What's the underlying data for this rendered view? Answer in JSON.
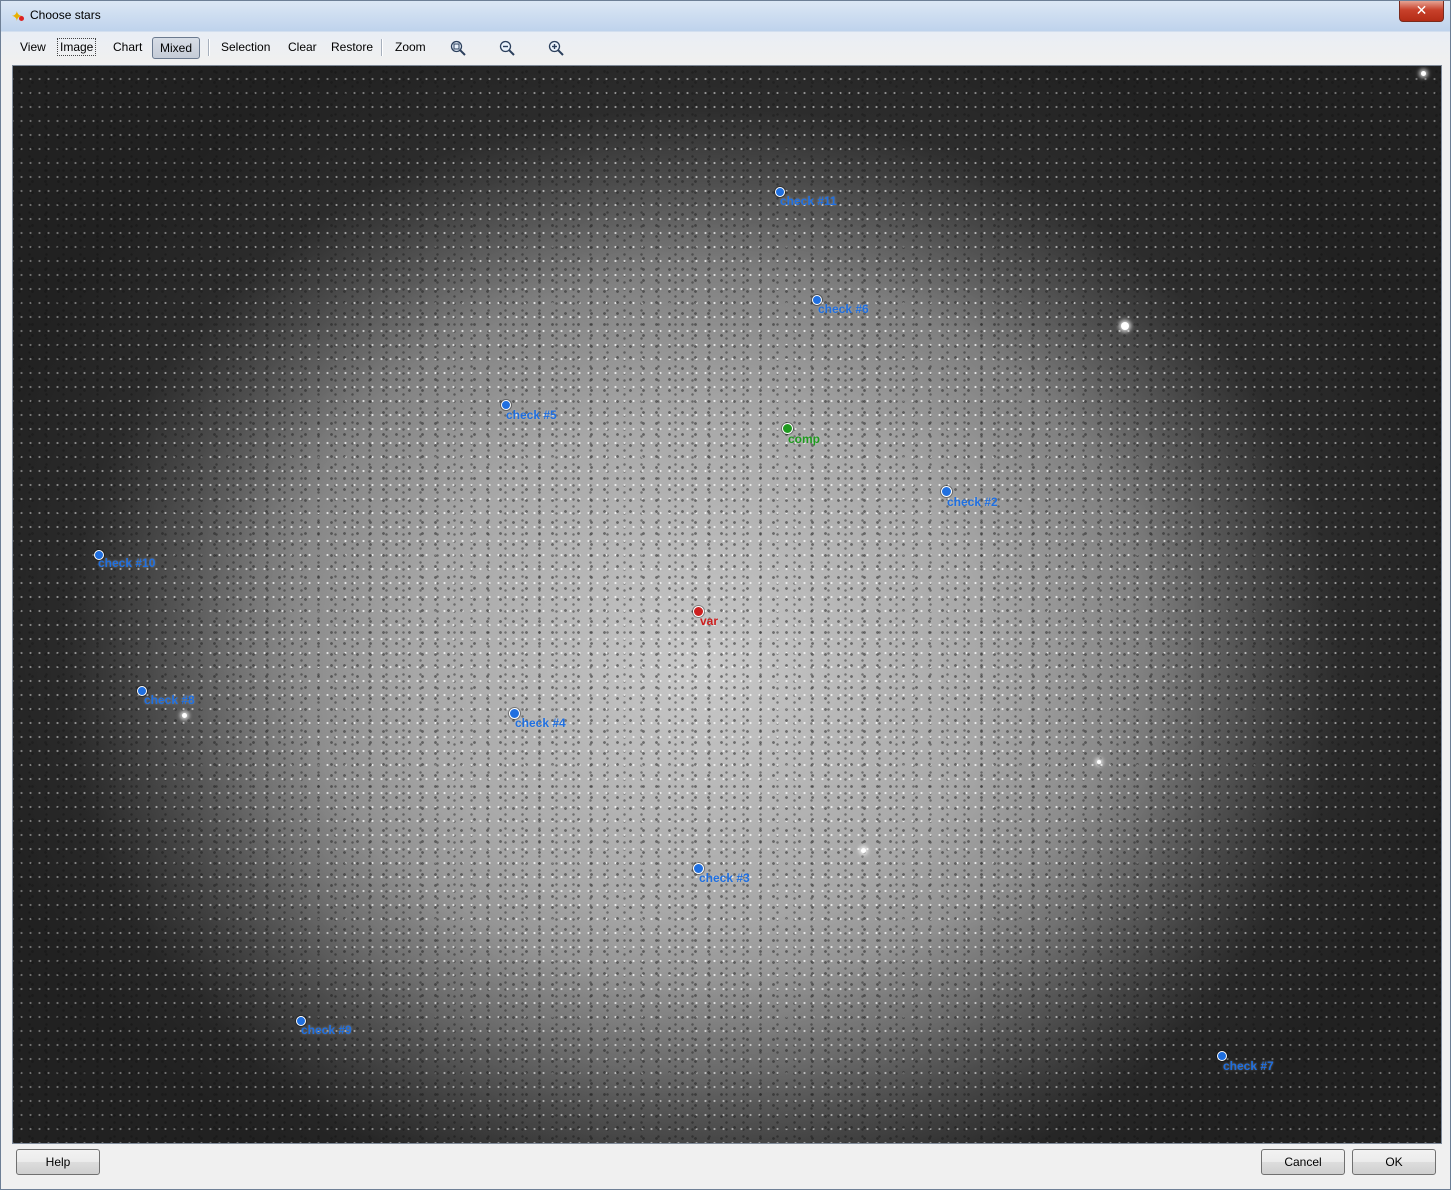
{
  "window": {
    "title": "Choose stars",
    "close_label": "✕"
  },
  "toolbar": {
    "view": "View",
    "image": "Image",
    "chart": "Chart",
    "mixed": "Mixed",
    "selection": "Selection",
    "clear": "Clear",
    "restore": "Restore",
    "zoom": "Zoom"
  },
  "stars": [
    {
      "id": "check-11",
      "label": "check #11",
      "color": "#1f6fe0"
    },
    {
      "id": "check-6",
      "label": "check #6",
      "color": "#1f6fe0"
    },
    {
      "id": "check-5",
      "label": "check #5",
      "color": "#1f6fe0"
    },
    {
      "id": "comp",
      "label": "comp",
      "color": "#1f9a1f"
    },
    {
      "id": "check-2",
      "label": "check #2",
      "color": "#1f6fe0"
    },
    {
      "id": "check-10",
      "label": "check #10",
      "color": "#1f6fe0"
    },
    {
      "id": "var",
      "label": "var",
      "color": "#cc1f1f"
    },
    {
      "id": "check-8",
      "label": "check #8",
      "color": "#1f6fe0"
    },
    {
      "id": "check-4",
      "label": "check #4",
      "color": "#1f6fe0"
    },
    {
      "id": "check-3",
      "label": "check #3",
      "color": "#1f6fe0"
    },
    {
      "id": "check-9",
      "label": "check #9",
      "color": "#1f6fe0"
    },
    {
      "id": "check-7",
      "label": "check #7",
      "color": "#1f6fe0"
    }
  ],
  "buttons": {
    "help": "Help",
    "cancel": "Cancel",
    "ok": "OK"
  },
  "icons": {
    "app": "star-app-icon",
    "zoom_fit": "zoom-fit-icon",
    "zoom_out": "zoom-out-icon",
    "zoom_in": "zoom-in-icon"
  }
}
